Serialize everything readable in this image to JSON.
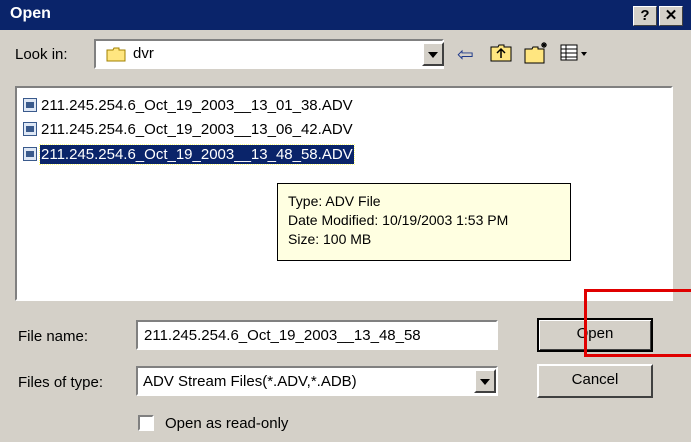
{
  "window": {
    "title": "Open",
    "help_label": "?",
    "close_label": "✕"
  },
  "lookin": {
    "label": "Look in:",
    "folder": "dvr"
  },
  "toolbar": {
    "back": "⇦",
    "up": "⮤",
    "new_folder": "✱",
    "views": "▦"
  },
  "files": [
    {
      "name": "211.245.254.6_Oct_19_2003__13_01_38.ADV",
      "selected": false
    },
    {
      "name": "211.245.254.6_Oct_19_2003__13_06_42.ADV",
      "selected": false
    },
    {
      "name": "211.245.254.6_Oct_19_2003__13_48_58.ADV",
      "selected": true
    }
  ],
  "tooltip": {
    "type": "Type: ADV File",
    "modified": "Date Modified: 10/19/2003 1:53 PM",
    "size": "Size: 100 MB"
  },
  "filename": {
    "label": "File name:",
    "value": "211.245.254.6_Oct_19_2003__13_48_58"
  },
  "filetype": {
    "label": "Files of type:",
    "value": "ADV Stream Files(*.ADV,*.ADB)"
  },
  "buttons": {
    "open": "Open",
    "cancel": "Cancel"
  },
  "readonly": {
    "label": "Open as read-only",
    "checked": false
  },
  "colors": {
    "titlebar": "#0a246a",
    "highlight": "#e00000",
    "tooltip": "#ffffe1"
  }
}
